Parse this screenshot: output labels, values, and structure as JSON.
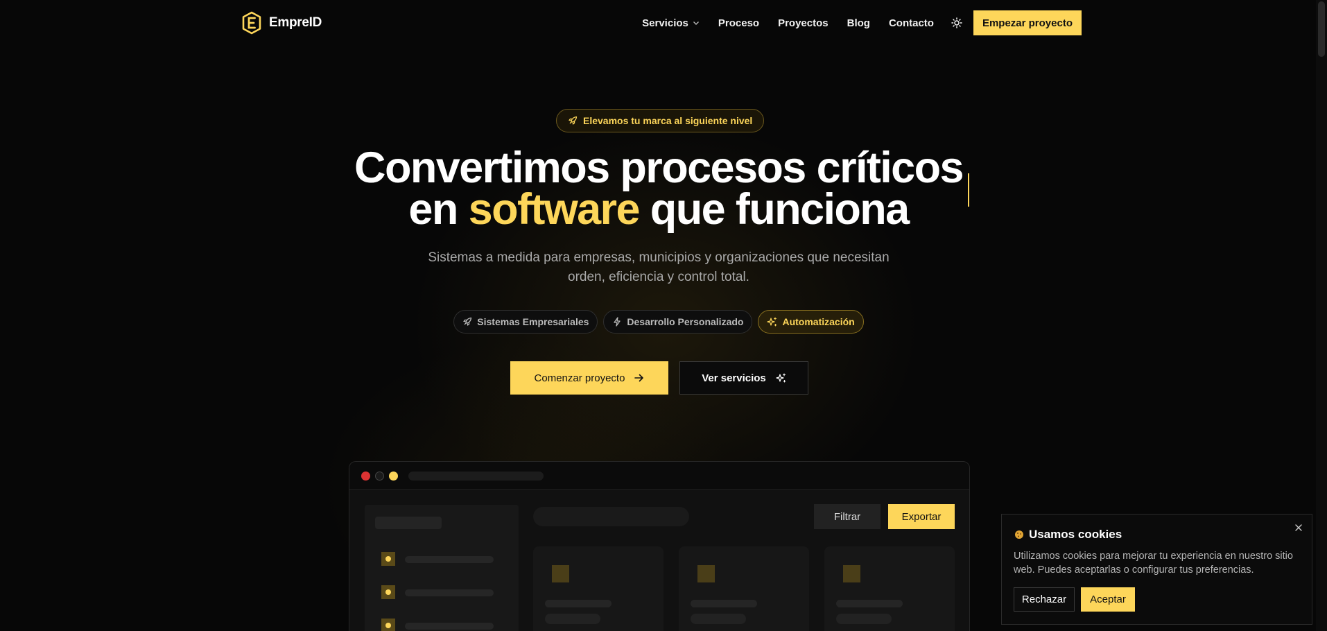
{
  "brand": {
    "name": "EmpreID",
    "accent": "#fdd65a"
  },
  "nav": {
    "items": [
      {
        "label": "Servicios",
        "has_dropdown": true
      },
      {
        "label": "Proceso"
      },
      {
        "label": "Proyectos"
      },
      {
        "label": "Blog"
      },
      {
        "label": "Contacto"
      }
    ],
    "theme_icon": "sun-icon",
    "cta_label": "Empezar proyecto"
  },
  "hero": {
    "badge": "Elevamos tu marca al siguiente nivel",
    "headline_line1": "Convertimos procesos críticos",
    "headline_pre": "en ",
    "headline_highlight": "software",
    "headline_post": " que funciona",
    "subtitle": "Sistemas a medida para empresas, municipios y organizaciones que necesitan orden, eficiencia y control total.",
    "chips": [
      {
        "label": "Sistemas Empresariales",
        "icon": "rocket-icon",
        "active": false
      },
      {
        "label": "Desarrollo Personalizado",
        "icon": "bolt-icon",
        "active": false
      },
      {
        "label": "Automatización",
        "icon": "sparkles-icon",
        "active": true
      }
    ],
    "primary_button": "Comenzar proyecto",
    "secondary_button": "Ver servicios"
  },
  "mock": {
    "filter_label": "Filtrar",
    "export_label": "Exportar"
  },
  "cookie": {
    "title": "Usamos cookies",
    "text": "Utilizamos cookies para mejorar tu experiencia en nuestro sitio web. Puedes aceptarlas o configurar tus preferencias.",
    "reject_label": "Rechazar",
    "accept_label": "Aceptar"
  }
}
